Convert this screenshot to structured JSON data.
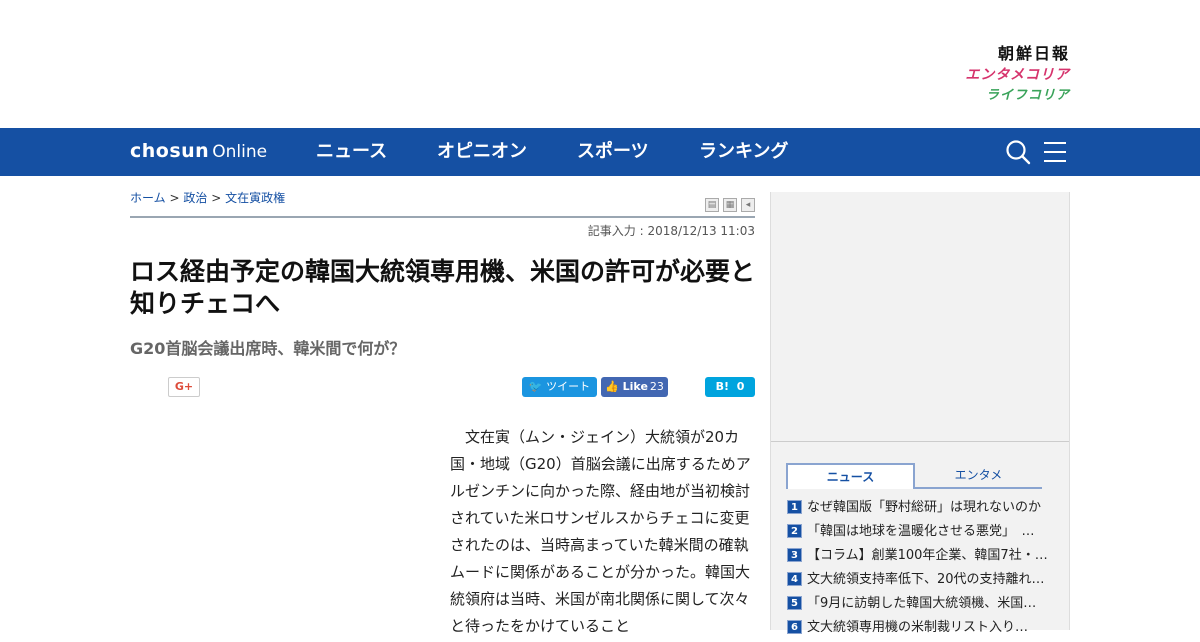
{
  "brands": {
    "chosun_ilbo": "朝鮮日報",
    "entame_korea": "エンタメコリア",
    "life_korea": "ライフコリア"
  },
  "nav": {
    "logo_bold": "chosun",
    "logo_light": "Online",
    "items": [
      "ニュース",
      "オピニオン",
      "スポーツ",
      "ランキング"
    ]
  },
  "breadcrumb": {
    "home": "ホーム",
    "sep": ">",
    "politics": "政治",
    "section": "文在寅政権"
  },
  "article": {
    "dateline": "記事入力 : 2018/12/13 11:03",
    "headline": "ロス経由予定の韓国大統領専用機、米国の許可が必要と知りチェコへ",
    "subhead": "G20首脳会議出席時、韓米間で何が？",
    "body": "文在寅（ムン・ジェイン）大統領が20カ国・地域（G20）首脳会議に出席するためアルゼンチンに向かった際、経由地が当初検討されていた米ロサンゼルスからチェコに変更されたのは、当時高まっていた韓米間の確執ムードに関係があることが分かった。韓国大統領府は当時、米国が南北関係に関して次々と待ったをかけていること"
  },
  "share": {
    "gplus": "G+",
    "tweet": "ツイート",
    "fb_like": "Like",
    "fb_count": "23",
    "hatena": "B!",
    "hatena_count": "0"
  },
  "sidebar": {
    "tabs": [
      "ニュース",
      "エンタメ"
    ],
    "ranking": [
      {
        "num": "1",
        "title": "なぜ韓国版「野村総研」は現れないのか"
      },
      {
        "num": "2",
        "title": "「韓国は地球を温暖化させる悪党」　…"
      },
      {
        "num": "3",
        "title": "【コラム】創業100年企業、韓国7社・…"
      },
      {
        "num": "4",
        "title": "文大統領支持率低下、20代の支持離れ…"
      },
      {
        "num": "5",
        "title": "「9月に訪朝した韓国大統領機、米国…"
      },
      {
        "num": "6",
        "title": "文大統領専用機の米制裁リスト入り…"
      }
    ]
  },
  "colors": {
    "nav_blue": "#1550a3",
    "entame_pink": "#d6336c",
    "life_green": "#3aa35a"
  }
}
